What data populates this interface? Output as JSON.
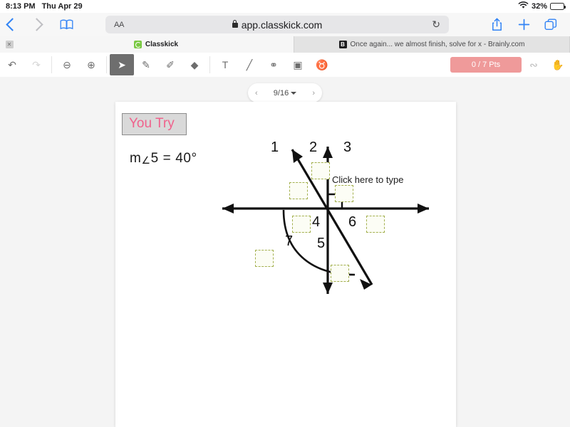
{
  "status_bar": {
    "time": "8:13 PM",
    "date": "Thu Apr 29",
    "wifi_icon": "wifi-icon",
    "battery_percent": "32%",
    "battery_icon": "battery-icon"
  },
  "browser": {
    "back_icon": "chevron-left-icon",
    "forward_icon": "chevron-right-icon",
    "bookmarks_icon": "book-icon",
    "text_size_label": "AA",
    "lock_icon": "lock-icon",
    "url": "app.classkick.com",
    "reload_icon": "reload-icon",
    "share_icon": "share-icon",
    "new_tab_icon": "plus-icon",
    "tabs_overview_icon": "tabs-icon",
    "tabs": [
      {
        "title": "Classkick",
        "favicon": "classkick-icon",
        "active": true,
        "close_icon": "close-icon"
      },
      {
        "title": "Once again... we almost finish, solve for x - Brainly.com",
        "favicon": "brainly-icon",
        "active": false
      }
    ]
  },
  "app_toolbar": {
    "tools": [
      {
        "name": "undo",
        "glyph": "↶",
        "state": "enabled"
      },
      {
        "name": "redo",
        "glyph": "↷",
        "state": "disabled"
      },
      {
        "name": "zoom-out",
        "glyph": "⊖",
        "state": "enabled"
      },
      {
        "name": "zoom-in",
        "glyph": "⊕",
        "state": "enabled"
      },
      {
        "name": "select-cursor",
        "glyph": "➤",
        "state": "active"
      },
      {
        "name": "pen",
        "glyph": "✎",
        "state": "enabled"
      },
      {
        "name": "highlighter",
        "glyph": "✐",
        "state": "enabled"
      },
      {
        "name": "eraser",
        "glyph": "◆",
        "state": "enabled"
      },
      {
        "name": "text",
        "glyph": "T",
        "state": "enabled"
      },
      {
        "name": "line",
        "glyph": "╱",
        "state": "enabled"
      },
      {
        "name": "link",
        "glyph": "⚭",
        "state": "enabled"
      },
      {
        "name": "camera",
        "glyph": "▣",
        "state": "enabled"
      },
      {
        "name": "microphone",
        "glyph": "♉",
        "state": "enabled"
      }
    ],
    "points_badge": "0 / 7 Pts",
    "signature_icon": "signature-icon",
    "hand_icon": "hand-icon"
  },
  "page_nav": {
    "prev_icon": "‹",
    "label": "9/16",
    "next_icon": "›",
    "dropdown_icon": "caret-down-icon"
  },
  "worksheet": {
    "heading": "You Try",
    "given": "m∥5 = 40°",
    "given_parts": {
      "m": "m",
      "angle": "∠",
      "rest": "5 = 40°"
    },
    "type_prompt": "Click here to type",
    "angle_labels": [
      "1",
      "2",
      "3",
      "4",
      "5",
      "6",
      "7"
    ],
    "answer_box_count": 7,
    "colors": {
      "heading_text": "#f0628c",
      "heading_bg": "#d9d9d9",
      "answer_box_border": "#a3b04e",
      "points_badge": "#ef9a9a",
      "accent_blue": "#3183f5"
    }
  }
}
